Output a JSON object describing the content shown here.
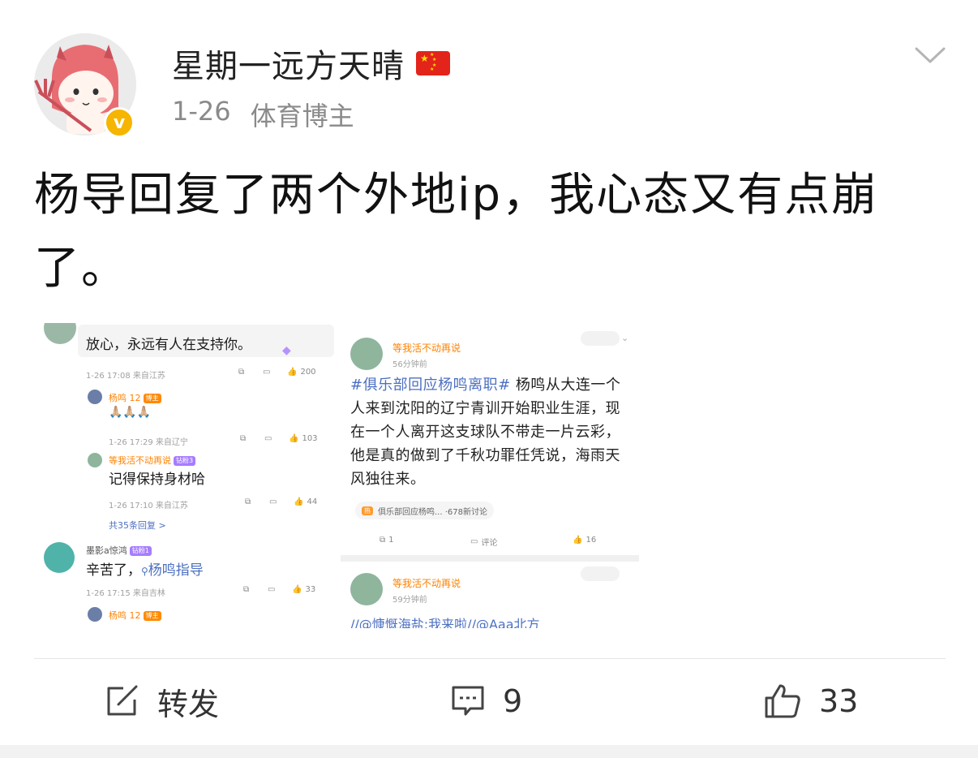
{
  "post": {
    "username": "星期一远方天晴",
    "date": "1-26",
    "identity": "体育博主",
    "verified_mark": "v",
    "text": "杨导回复了两个外地ip，我心态又有点崩了。"
  },
  "embedded": {
    "left": {
      "comment1": {
        "text": "放心，永远有人在支持你。",
        "meta": "1-26 17:08  来自江苏",
        "likes": "200"
      },
      "reply1": {
        "name": "杨鸣 12",
        "tag": "博主",
        "text": "🙏🏼🙏🏼🙏🏼",
        "meta": "1-26 17:29  来自辽宁",
        "likes": "103"
      },
      "reply2": {
        "name": "等我活不动再说",
        "tag": "钻粉3",
        "text": "记得保持身材哈",
        "meta": "1-26 17:10  来自江苏",
        "likes": "44"
      },
      "more": "共35条回复 >",
      "comment2": {
        "name": "墨影a惊鸿",
        "tag": "钻粉1",
        "text_prefix": "辛苦了，",
        "mention": "杨鸣指导",
        "meta": "1-26 17:15  来自吉林",
        "likes": "33"
      },
      "reply3": {
        "name": "杨鸣 12",
        "tag": "博主"
      }
    },
    "right": {
      "post1": {
        "name": "等我活不动再说",
        "time": "56分钟前",
        "hashtag": "#俱乐部回应杨鸣离职#",
        "body": " 杨鸣从大连一个人来到沈阳的辽宁青训开始职业生涯，现在一个人离开这支球队不带走一片云彩，他是真的做到了千秋功罪任凭说，海雨天风独往来。",
        "chip_tag": "热",
        "chip_text": "俱乐部回应杨鸣...  ·678新讨论",
        "reposts": "1",
        "comment_label": "评论",
        "likes": "16"
      },
      "post2": {
        "name": "等我活不动再说",
        "time": "59分钟前",
        "text": "//@慷慨海盐:我来啦//@Aaa北方"
      }
    }
  },
  "actions": {
    "repost_label": "转发",
    "comments": "9",
    "likes": "33"
  },
  "colors": {
    "accent_orange": "#ff8200",
    "link_blue": "#4d70c2",
    "verified_gold": "#f5b500"
  }
}
